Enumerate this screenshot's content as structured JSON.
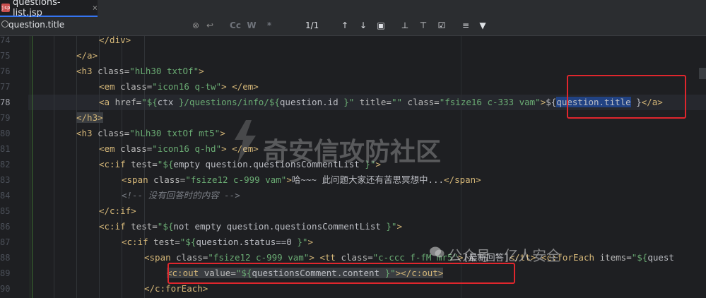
{
  "tab": {
    "filename": "questions-list.jsp",
    "file_icon_label": "jsp",
    "close": "×"
  },
  "search": {
    "query": "question.title",
    "match_count": "1/1",
    "buttons": [
      "Cc",
      "W",
      "*"
    ]
  },
  "gutter": {
    "line_numbers": [
      "74",
      "75",
      "76",
      "77",
      "78",
      "79",
      "80",
      "81",
      "82",
      "83",
      "84",
      "85",
      "86",
      "87",
      "88",
      "89",
      "90"
    ]
  },
  "code_lines": [
    "</div>",
    "</a>",
    "<h3 class=\"hLh30 txtOf\">",
    "<em class=\"icon16 q-tw\"> </em>",
    "<a href=\"${ctx }/questions/info/${question.id }\" title=\"\" class=\"fsize16 c-333 vam\">${question.title }</a>",
    "</h3>",
    "<h3 class=\"hLh30 txtOf mt5\">",
    "<em class=\"icon16 q-hd\"> </em>",
    "<c:if test=\"${empty question.questionsCommentList }\">",
    "<span class=\"fsize12 c-999 vam\">哈~~~ 此问题大家还有苦思冥想中...</span>",
    "<!-- 没有回答时的内容 -->",
    "</c:if>",
    "<c:if test=\"${not empty question.questionsCommentList }\">",
    "<c:if test=\"${question.status==0 }\">",
    "<span class=\"fsize12 c-999 vam\"> <tt class=\"c-ccc f-fM mr5\">[最新回答]</tt> <c:forEach items=\"${quest",
    "<c:out value=\"${questionsComment.content }\"></c:out>",
    "</c:forEach>"
  ],
  "watermarks": {
    "center": "奇安信攻防社区",
    "bottom": "公众号 · 亿人安全"
  },
  "colors": {
    "tag": "#d5b778",
    "string": "#6aab73",
    "comment": "#7a7e85",
    "highlight_box": "#e0262d",
    "selection": "#214283"
  }
}
